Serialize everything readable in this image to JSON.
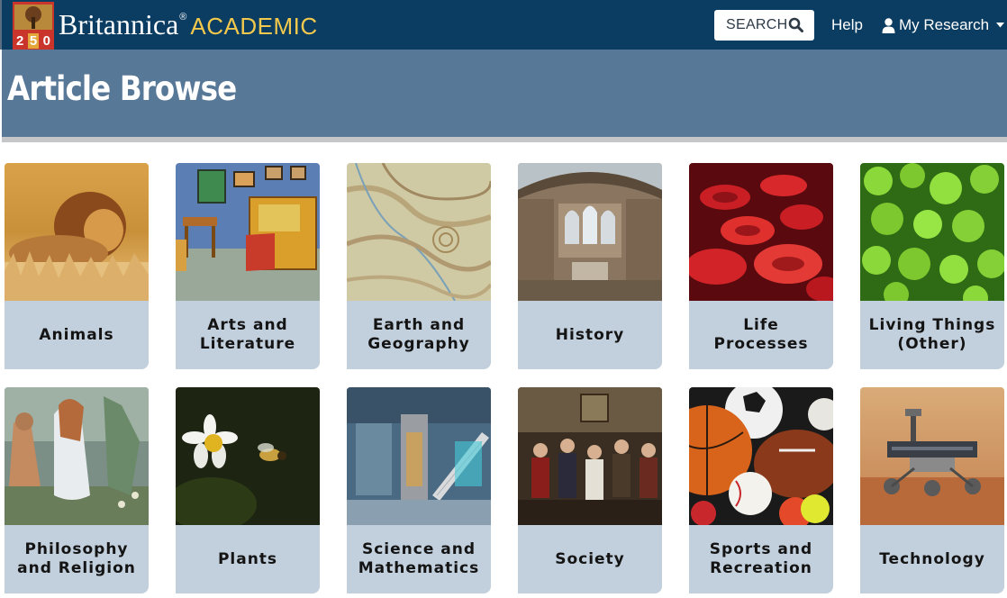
{
  "brand": {
    "logo_numbers": [
      "2",
      "5",
      "0"
    ],
    "name": "Britannica",
    "reg_mark": "®",
    "sub": "ACADEMIC"
  },
  "nav": {
    "search_label": "SEARCH",
    "help_label": "Help",
    "research_label": "My Research"
  },
  "page": {
    "title": "Article Browse"
  },
  "categories": [
    {
      "label": "Animals"
    },
    {
      "label": "Arts and Literature"
    },
    {
      "label": "Earth and Geography"
    },
    {
      "label": "History"
    },
    {
      "label": "Life Processes"
    },
    {
      "label": "Living Things (Other)"
    },
    {
      "label": "Philosophy and Religion"
    },
    {
      "label": "Plants"
    },
    {
      "label": "Science and Mathematics"
    },
    {
      "label": "Society"
    },
    {
      "label": "Sports and Recreation"
    },
    {
      "label": "Technology"
    }
  ],
  "colors": {
    "topbar": "#0b3c61",
    "header_band": "#587898",
    "label_bg": "#c2cfdc",
    "brand_accent": "#f2c94c"
  },
  "icons": {
    "search": "search-icon",
    "user": "user-icon",
    "caret": "caret-down-icon"
  }
}
